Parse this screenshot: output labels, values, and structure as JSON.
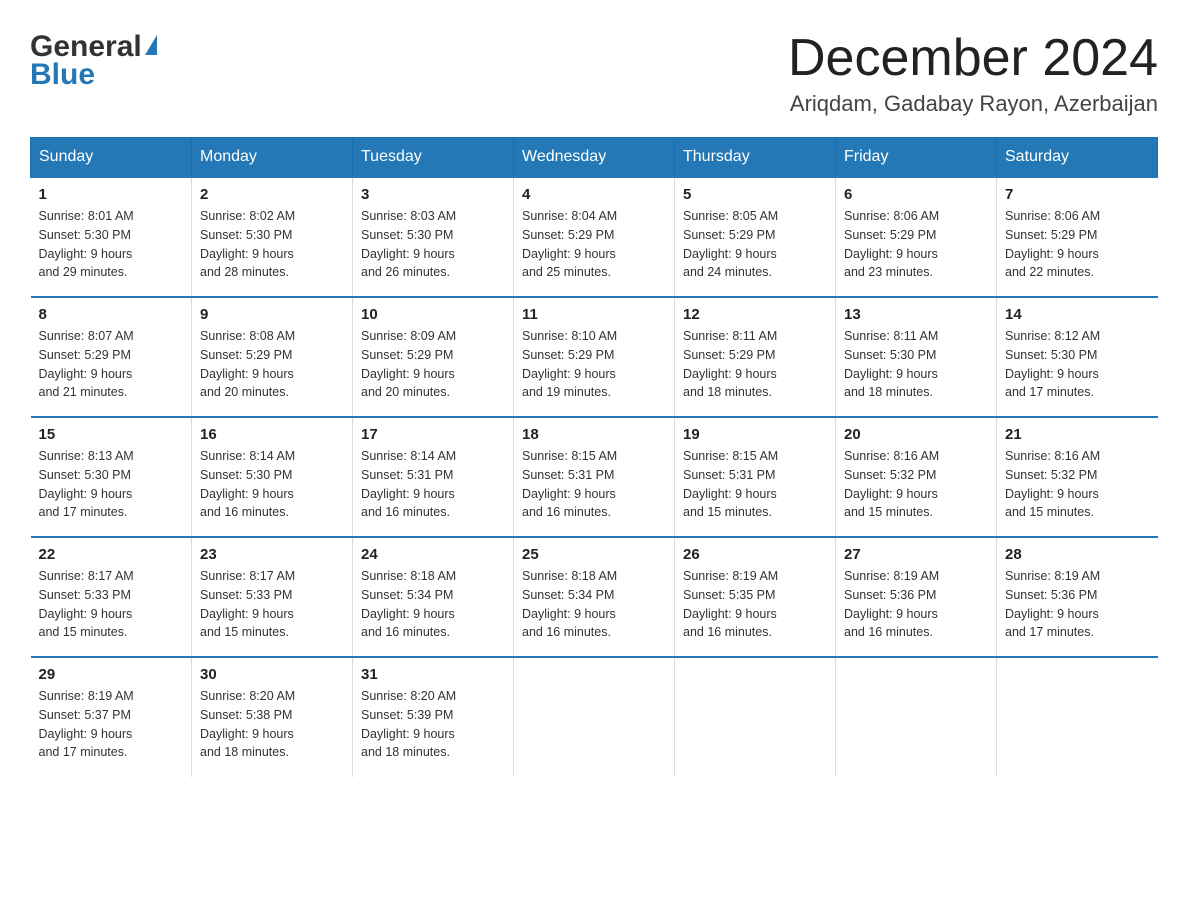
{
  "header": {
    "month_year": "December 2024",
    "location": "Ariqdam, Gadabay Rayon, Azerbaijan",
    "logo_general": "General",
    "logo_blue": "Blue"
  },
  "days_of_week": [
    "Sunday",
    "Monday",
    "Tuesday",
    "Wednesday",
    "Thursday",
    "Friday",
    "Saturday"
  ],
  "weeks": [
    [
      {
        "day": "1",
        "sunrise": "8:01 AM",
        "sunset": "5:30 PM",
        "daylight": "9 hours and 29 minutes."
      },
      {
        "day": "2",
        "sunrise": "8:02 AM",
        "sunset": "5:30 PM",
        "daylight": "9 hours and 28 minutes."
      },
      {
        "day": "3",
        "sunrise": "8:03 AM",
        "sunset": "5:30 PM",
        "daylight": "9 hours and 26 minutes."
      },
      {
        "day": "4",
        "sunrise": "8:04 AM",
        "sunset": "5:29 PM",
        "daylight": "9 hours and 25 minutes."
      },
      {
        "day": "5",
        "sunrise": "8:05 AM",
        "sunset": "5:29 PM",
        "daylight": "9 hours and 24 minutes."
      },
      {
        "day": "6",
        "sunrise": "8:06 AM",
        "sunset": "5:29 PM",
        "daylight": "9 hours and 23 minutes."
      },
      {
        "day": "7",
        "sunrise": "8:06 AM",
        "sunset": "5:29 PM",
        "daylight": "9 hours and 22 minutes."
      }
    ],
    [
      {
        "day": "8",
        "sunrise": "8:07 AM",
        "sunset": "5:29 PM",
        "daylight": "9 hours and 21 minutes."
      },
      {
        "day": "9",
        "sunrise": "8:08 AM",
        "sunset": "5:29 PM",
        "daylight": "9 hours and 20 minutes."
      },
      {
        "day": "10",
        "sunrise": "8:09 AM",
        "sunset": "5:29 PM",
        "daylight": "9 hours and 20 minutes."
      },
      {
        "day": "11",
        "sunrise": "8:10 AM",
        "sunset": "5:29 PM",
        "daylight": "9 hours and 19 minutes."
      },
      {
        "day": "12",
        "sunrise": "8:11 AM",
        "sunset": "5:29 PM",
        "daylight": "9 hours and 18 minutes."
      },
      {
        "day": "13",
        "sunrise": "8:11 AM",
        "sunset": "5:30 PM",
        "daylight": "9 hours and 18 minutes."
      },
      {
        "day": "14",
        "sunrise": "8:12 AM",
        "sunset": "5:30 PM",
        "daylight": "9 hours and 17 minutes."
      }
    ],
    [
      {
        "day": "15",
        "sunrise": "8:13 AM",
        "sunset": "5:30 PM",
        "daylight": "9 hours and 17 minutes."
      },
      {
        "day": "16",
        "sunrise": "8:14 AM",
        "sunset": "5:30 PM",
        "daylight": "9 hours and 16 minutes."
      },
      {
        "day": "17",
        "sunrise": "8:14 AM",
        "sunset": "5:31 PM",
        "daylight": "9 hours and 16 minutes."
      },
      {
        "day": "18",
        "sunrise": "8:15 AM",
        "sunset": "5:31 PM",
        "daylight": "9 hours and 16 minutes."
      },
      {
        "day": "19",
        "sunrise": "8:15 AM",
        "sunset": "5:31 PM",
        "daylight": "9 hours and 15 minutes."
      },
      {
        "day": "20",
        "sunrise": "8:16 AM",
        "sunset": "5:32 PM",
        "daylight": "9 hours and 15 minutes."
      },
      {
        "day": "21",
        "sunrise": "8:16 AM",
        "sunset": "5:32 PM",
        "daylight": "9 hours and 15 minutes."
      }
    ],
    [
      {
        "day": "22",
        "sunrise": "8:17 AM",
        "sunset": "5:33 PM",
        "daylight": "9 hours and 15 minutes."
      },
      {
        "day": "23",
        "sunrise": "8:17 AM",
        "sunset": "5:33 PM",
        "daylight": "9 hours and 15 minutes."
      },
      {
        "day": "24",
        "sunrise": "8:18 AM",
        "sunset": "5:34 PM",
        "daylight": "9 hours and 16 minutes."
      },
      {
        "day": "25",
        "sunrise": "8:18 AM",
        "sunset": "5:34 PM",
        "daylight": "9 hours and 16 minutes."
      },
      {
        "day": "26",
        "sunrise": "8:19 AM",
        "sunset": "5:35 PM",
        "daylight": "9 hours and 16 minutes."
      },
      {
        "day": "27",
        "sunrise": "8:19 AM",
        "sunset": "5:36 PM",
        "daylight": "9 hours and 16 minutes."
      },
      {
        "day": "28",
        "sunrise": "8:19 AM",
        "sunset": "5:36 PM",
        "daylight": "9 hours and 17 minutes."
      }
    ],
    [
      {
        "day": "29",
        "sunrise": "8:19 AM",
        "sunset": "5:37 PM",
        "daylight": "9 hours and 17 minutes."
      },
      {
        "day": "30",
        "sunrise": "8:20 AM",
        "sunset": "5:38 PM",
        "daylight": "9 hours and 18 minutes."
      },
      {
        "day": "31",
        "sunrise": "8:20 AM",
        "sunset": "5:39 PM",
        "daylight": "9 hours and 18 minutes."
      },
      null,
      null,
      null,
      null
    ]
  ],
  "labels": {
    "sunrise": "Sunrise:",
    "sunset": "Sunset:",
    "daylight": "Daylight:"
  }
}
